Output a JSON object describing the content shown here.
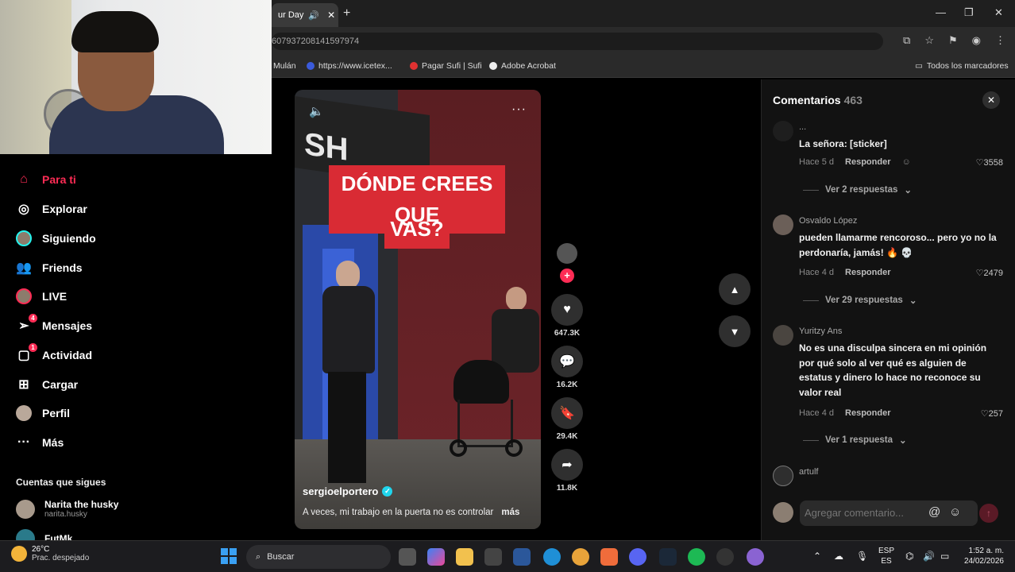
{
  "browser": {
    "tab_title": "ur Day",
    "url": "607937208141597974",
    "bookmarks": [
      {
        "label": "Mulán",
        "color": "#2f2f2f"
      },
      {
        "label": "https://www.icetex...",
        "color": "#3b5bdb"
      },
      {
        "label": "Pagar Sufi | Sufi",
        "color": "#e03131"
      },
      {
        "label": "Adobe Acrobat",
        "color": "#ffffff"
      }
    ],
    "all_bookmarks": "Todos los marcadores"
  },
  "sidebar": {
    "items": [
      {
        "label": "Para ti",
        "icon": "home-icon"
      },
      {
        "label": "Explorar",
        "icon": "compass-icon"
      },
      {
        "label": "Siguiendo",
        "icon": "following-avatar-icon"
      },
      {
        "label": "Friends",
        "icon": "friends-icon"
      },
      {
        "label": "LIVE",
        "icon": "live-icon"
      },
      {
        "label": "Mensajes",
        "icon": "send-icon",
        "badge": "4"
      },
      {
        "label": "Actividad",
        "icon": "activity-icon",
        "badge": "1"
      },
      {
        "label": "Cargar",
        "icon": "upload-icon"
      },
      {
        "label": "Perfil",
        "icon": "profile-avatar-icon"
      },
      {
        "label": "Más",
        "icon": "more-icon"
      }
    ],
    "following_header": "Cuentas que sigues",
    "following": [
      {
        "name": "Narita the husky",
        "handle": "narita.husky"
      },
      {
        "name": "FutMk",
        "handle": ""
      }
    ]
  },
  "video": {
    "caption_line1": "DÓNDE CREES QUE",
    "caption_line2": "VAS?",
    "sign_text": "SH",
    "username": "sergioelportero",
    "description": "A veces, mi trabajo en la puerta no es controlar",
    "more": "más",
    "likes": "647.3K",
    "comments": "16.2K",
    "saves": "29.4K",
    "shares": "11.8K"
  },
  "comments": {
    "title": "Comentarios",
    "count": "463",
    "items": [
      {
        "name": "...",
        "text": "La señora: [sticker]",
        "time": "Hace 5 d",
        "reply": "Responder",
        "likes": "3558",
        "view_replies": "Ver 2 respuestas"
      },
      {
        "name": "Osvaldo López",
        "text": "pueden llamarme rencoroso... pero yo no la perdonaría, jamás! 🔥 💀",
        "time": "Hace 4 d",
        "reply": "Responder",
        "likes": "2479",
        "view_replies": "Ver 29 respuestas"
      },
      {
        "name": "Yuritzy Ans",
        "text": "No es una disculpa sincera en mi opinión por qué solo al ver qué es alguien de estatus y dinero lo hace no reconoce su valor real",
        "time": "Hace 4 d",
        "reply": "Responder",
        "likes": "257",
        "view_replies": "Ver 1 respuesta"
      },
      {
        "name": "artulf",
        "text": "",
        "time": "",
        "reply": "",
        "likes": "",
        "view_replies": ""
      }
    ],
    "input_placeholder": "Agregar comentario..."
  },
  "taskbar": {
    "temp": "26°C",
    "weather": "Prac. despejado",
    "search": "Buscar",
    "lang1": "ESP",
    "lang2": "ES",
    "time": "1:52 a. m.",
    "date": "24/02/2026",
    "spotify_badge": "",
    "discord_badge": "99+"
  },
  "colors": {
    "accent": "#fe2c55",
    "verified": "#20d5ec",
    "caption_bg": "#d92b34"
  }
}
